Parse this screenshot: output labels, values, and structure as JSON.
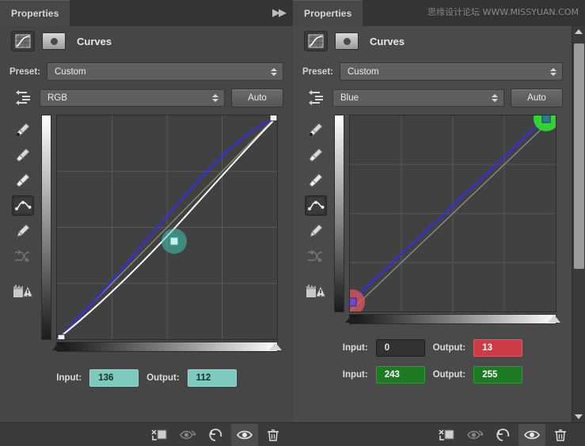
{
  "left_panel": {
    "tab_label": "Properties",
    "collapse_icon": "collapse-right-icon",
    "title": "Curves",
    "preset_label": "Preset:",
    "preset_value": "Custom",
    "channel_value": "RGB",
    "auto_label": "Auto",
    "tools": [
      "sample-gray-eyedropper-icon",
      "sample-black-eyedropper-icon",
      "sample-white-eyedropper-icon",
      "curve-point-tool-icon",
      "pencil-draw-tool-icon",
      "smooth-curve-icon",
      "clipping-warning-icon"
    ],
    "input_label": "Input:",
    "input_value": "136",
    "output_label": "Output:",
    "output_value": "112",
    "input_color": "#7dc9bd",
    "output_color": "#7dc9bd",
    "footer_buttons": [
      "clip-to-layer-icon",
      "toggle-preview-icon",
      "reset-adjustment-icon",
      "visibility-eye-icon",
      "delete-layer-icon"
    ]
  },
  "right_panel": {
    "tab_label": "Properties",
    "watermark": "思缘设计论坛  WWW.MISSYUAN.COM",
    "title": "Curves",
    "preset_label": "Preset:",
    "preset_value": "Custom",
    "channel_value": "Blue",
    "auto_label": "Auto",
    "tools": [
      "sample-gray-eyedropper-icon",
      "sample-black-eyedropper-icon",
      "sample-white-eyedropper-icon",
      "curve-point-tool-icon",
      "pencil-draw-tool-icon",
      "smooth-curve-icon",
      "clipping-warning-icon"
    ],
    "io_rows": [
      {
        "input_label": "Input:",
        "input_value": "0",
        "input_style": "dark",
        "output_label": "Output:",
        "output_value": "13",
        "output_style": "red",
        "output_color": "#cf3b45"
      },
      {
        "input_label": "Input:",
        "input_value": "243",
        "input_style": "green",
        "output_label": "Output:",
        "output_value": "255",
        "output_style": "green",
        "output_color": "#1d7a23"
      }
    ],
    "footer_buttons": [
      "clip-to-layer-icon",
      "toggle-preview-icon",
      "reset-adjustment-icon",
      "visibility-eye-icon",
      "delete-layer-icon"
    ]
  },
  "chart_data": [
    {
      "type": "line",
      "title": "RGB Curves",
      "xlabel": "Input",
      "ylabel": "Output",
      "xlim": [
        0,
        255
      ],
      "ylim": [
        0,
        255
      ],
      "grid": true,
      "series": [
        {
          "name": "baseline-diagonal",
          "color": "#8a8a7a",
          "x": [
            0,
            255
          ],
          "values": [
            0,
            255
          ]
        },
        {
          "name": "blue-channel-curve",
          "color": "#3333cc",
          "x": [
            0,
            64,
            128,
            192,
            255
          ],
          "values": [
            0,
            92,
            160,
            214,
            255
          ]
        },
        {
          "name": "rgb-composite-curve",
          "color": "#ffffff",
          "x": [
            0,
            64,
            136,
            192,
            255
          ],
          "values": [
            0,
            44,
            112,
            176,
            255
          ]
        }
      ],
      "control_points": [
        {
          "name": "black-point",
          "input": 0,
          "output": 0,
          "highlight": "none"
        },
        {
          "name": "mid-point",
          "input": 136,
          "output": 112,
          "highlight": "#44c8b4"
        },
        {
          "name": "white-point",
          "input": 255,
          "output": 255,
          "highlight": "none"
        }
      ]
    },
    {
      "type": "line",
      "title": "Blue Channel Curve",
      "xlabel": "Input",
      "ylabel": "Output",
      "xlim": [
        0,
        255
      ],
      "ylim": [
        0,
        255
      ],
      "grid": true,
      "series": [
        {
          "name": "baseline-diagonal",
          "color": "#8a8a8a",
          "x": [
            0,
            255
          ],
          "values": [
            0,
            255
          ]
        },
        {
          "name": "blue-channel-curve",
          "color": "#3333cc",
          "x": [
            0,
            243
          ],
          "values": [
            13,
            255
          ]
        }
      ],
      "control_points": [
        {
          "name": "black-point",
          "input": 0,
          "output": 13,
          "highlight": "#e0555e"
        },
        {
          "name": "white-point",
          "input": 243,
          "output": 255,
          "highlight": "#33d933"
        }
      ]
    }
  ]
}
